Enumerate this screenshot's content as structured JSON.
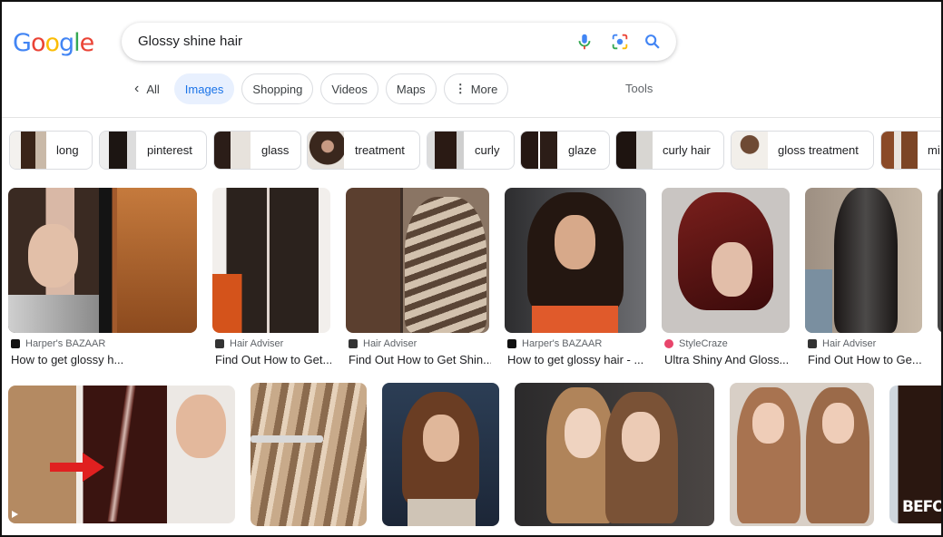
{
  "logo": {
    "letters": [
      "G",
      "o",
      "o",
      "g",
      "l",
      "e"
    ],
    "colors": [
      "#4285f4",
      "#ea4335",
      "#fbbc05",
      "#4285f4",
      "#34a853",
      "#ea4335"
    ]
  },
  "search": {
    "query": "Glossy shine hair",
    "icons": [
      "microphone-icon",
      "lens-icon",
      "search-icon"
    ]
  },
  "tabs": [
    {
      "label": "All",
      "icon": "chevron-left-icon",
      "active": false
    },
    {
      "label": "Images",
      "active": true
    },
    {
      "label": "Shopping",
      "active": false
    },
    {
      "label": "Videos",
      "active": false
    },
    {
      "label": "Maps",
      "active": false
    },
    {
      "label": "More",
      "icon": "more-vertical-icon",
      "active": false
    }
  ],
  "tools_label": "Tools",
  "chips": [
    "long",
    "pinterest",
    "glass",
    "treatment",
    "curly",
    "glaze",
    "curly hair",
    "gloss treatment",
    "mi"
  ],
  "results_row1": [
    {
      "source": "Harper's BAZAAR",
      "title": "How to get glossy h...",
      "fav_color": "#111111"
    },
    {
      "source": "Hair Adviser",
      "title": "Find Out How to Get...",
      "fav_color": "#333333"
    },
    {
      "source": "Hair Adviser",
      "title": "Find Out How to Get Shin...",
      "fav_color": "#333333"
    },
    {
      "source": "Harper's BAZAAR",
      "title": "How to get glossy hair - ...",
      "fav_color": "#111111"
    },
    {
      "source": "StyleCraze",
      "title": "Ultra Shiny And Gloss...",
      "fav_color": "#e8456b"
    },
    {
      "source": "Hair Adviser",
      "title": "Find Out How to Ge...",
      "fav_color": "#333333"
    }
  ],
  "results_row2_overlay_text": "BEFO",
  "colors": {
    "accent": "#1a73e8",
    "active_tab_bg": "#e8f0fe",
    "arrow": "#e02020"
  }
}
